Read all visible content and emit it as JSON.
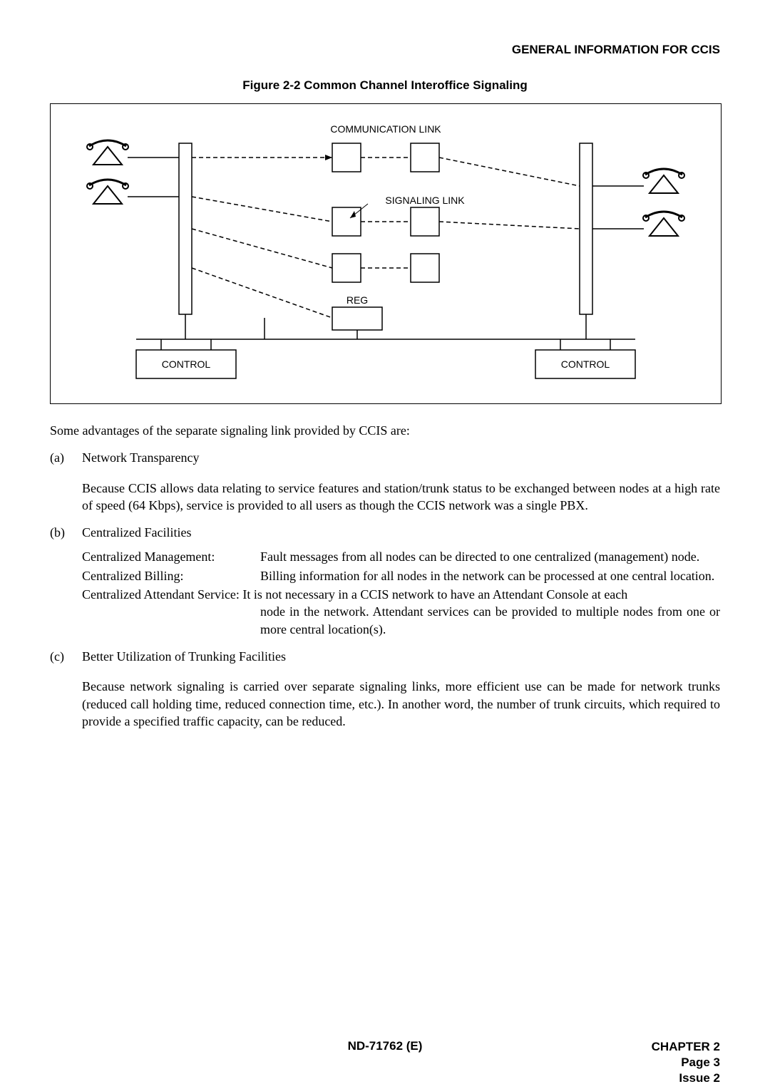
{
  "header": {
    "right": "GENERAL INFORMATION FOR CCIS"
  },
  "figure": {
    "caption": "Figure 2-2   Common Channel Interoffice Signaling",
    "labels": {
      "comm_link": "COMMUNICATION LINK",
      "sig_link": "SIGNALING LINK",
      "reg": "REG",
      "control_left": "CONTROL",
      "control_right": "CONTROL"
    }
  },
  "intro": "Some advantages of the separate signaling link provided by CCIS are:",
  "items": {
    "a": {
      "marker": "(a)",
      "title": "Network Transparency",
      "para": "Because CCIS allows data relating to service features and station/trunk status to be exchanged between nodes at a high rate of speed (64 Kbps), service is provided to all users as though the CCIS network was a single PBX."
    },
    "b": {
      "marker": "(b)",
      "title": "Centralized Facilities",
      "defs": {
        "cm_term": "Centralized Management:",
        "cm_desc": "Fault messages from all nodes can be directed to one centralized (management) node.",
        "cb_term": "Centralized Billing:",
        "cb_desc": "Billing information for all nodes in the network can be processed at one central location.",
        "cas_line1": "Centralized Attendant Service: It is not necessary in a CCIS network to have an Attendant Console at each",
        "cas_line2": "node in the network. Attendant services can be provided to multiple nodes from one or more central location(s)."
      }
    },
    "c": {
      "marker": "(c)",
      "title": "Better Utilization of Trunking Facilities",
      "para": "Because network signaling is carried over separate signaling links, more efficient use can be made for network trunks (reduced call holding time, reduced connection time, etc.). In another word, the number of trunk circuits, which required to provide a specified traffic capacity, can be reduced."
    }
  },
  "footer": {
    "center": "ND-71762 (E)",
    "chapter": "CHAPTER 2",
    "page": "Page 3",
    "issue": "Issue 2"
  }
}
